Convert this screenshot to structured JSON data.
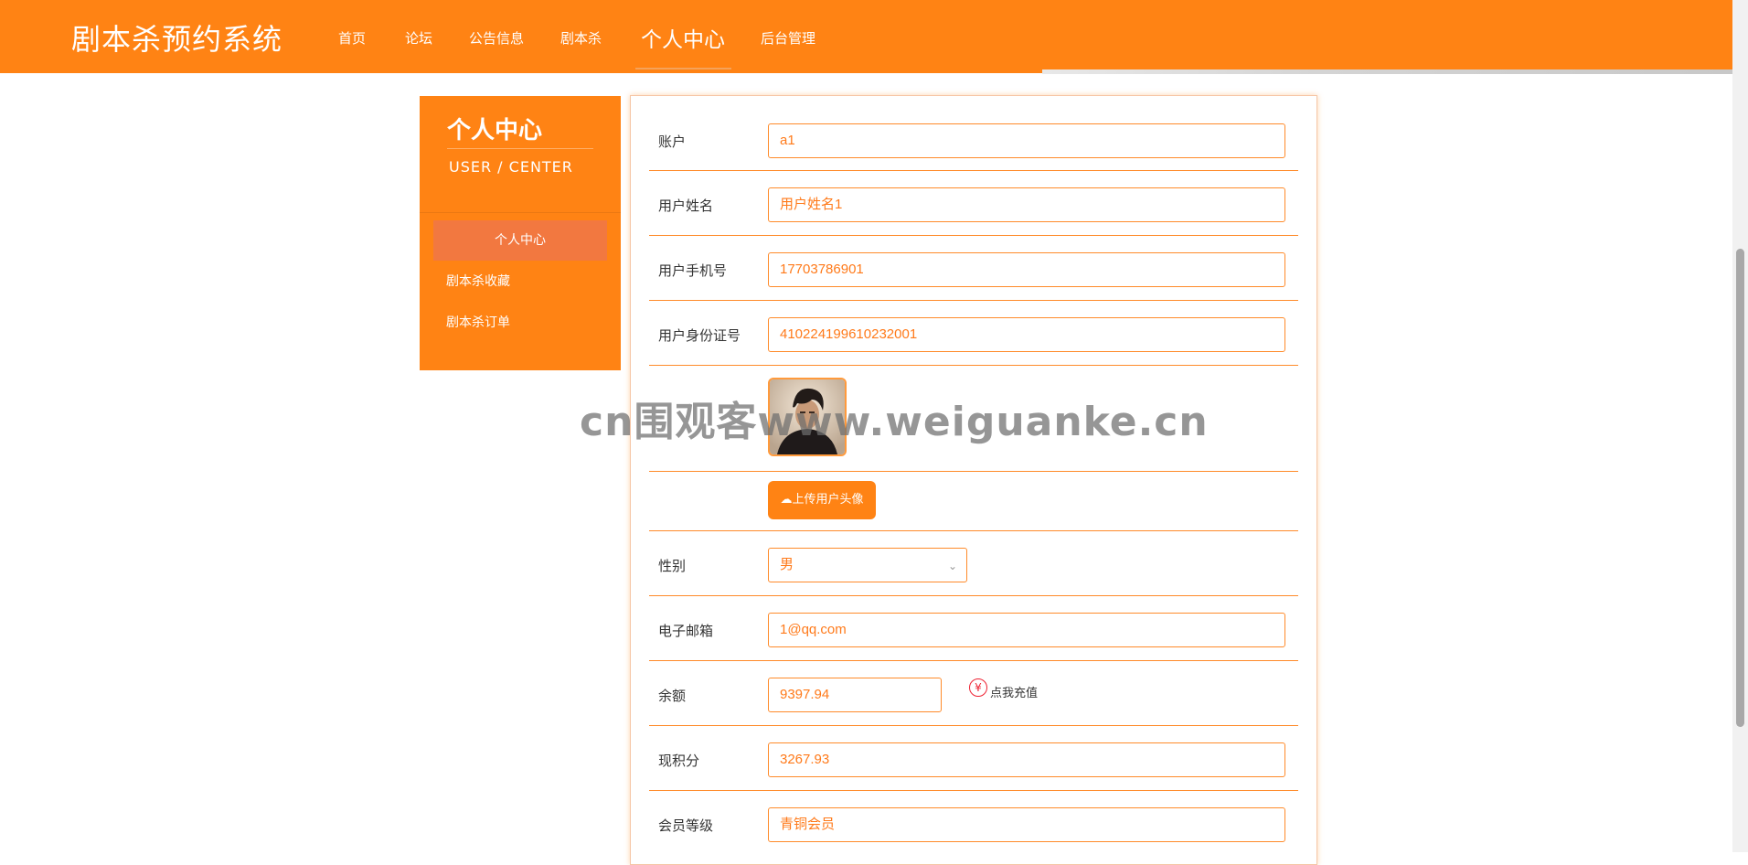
{
  "header": {
    "brand": "剧本杀预约系统",
    "nav": [
      {
        "label": "首页"
      },
      {
        "label": "论坛"
      },
      {
        "label": "公告信息"
      },
      {
        "label": "剧本杀"
      },
      {
        "label": "个人中心",
        "active": true
      },
      {
        "label": "后台管理"
      }
    ]
  },
  "sidebar": {
    "title": "个人中心",
    "subtitle": "USER / CENTER",
    "items": [
      {
        "label": "个人中心",
        "active": true
      },
      {
        "label": "剧本杀收藏"
      },
      {
        "label": "剧本杀订单"
      }
    ]
  },
  "form": {
    "account": {
      "label": "账户",
      "value": "a1"
    },
    "name": {
      "label": "用户姓名",
      "value": "用户姓名1"
    },
    "phone": {
      "label": "用户手机号",
      "value": "17703786901"
    },
    "idcard": {
      "label": "用户身份证号",
      "value": "410224199610232001"
    },
    "upload_label": "上传用户头像",
    "gender": {
      "label": "性别",
      "value": "男"
    },
    "email": {
      "label": "电子邮箱",
      "value": "1@qq.com"
    },
    "balance": {
      "label": "余额",
      "value": "9397.94",
      "recharge": "点我充值"
    },
    "points": {
      "label": "现积分",
      "value": "3267.93"
    },
    "level": {
      "label": "会员等级",
      "value": "青铜会员"
    }
  },
  "watermark": "cn围观客www.weiguanke.cn",
  "colors": {
    "primary": "#ff8314",
    "sidebar_active": "#f27840"
  }
}
